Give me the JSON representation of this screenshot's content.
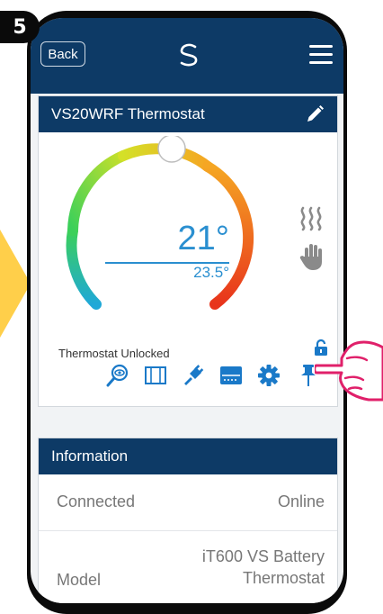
{
  "step_number": "5",
  "topbar": {
    "back_label": "Back",
    "logo_icon": "salus-logo-icon",
    "menu_icon": "hamburger-menu-icon"
  },
  "device": {
    "title": "VS20WRF Thermostat",
    "setpoint": "21°",
    "current_temp": "23.5°",
    "lock_status": "Thermostat Unlocked"
  },
  "tools": [
    "magnifier-eye-icon",
    "window-icon",
    "plug-icon",
    "display-icon",
    "gear-icon",
    "pin-icon"
  ],
  "information": {
    "title": "Information",
    "rows": [
      {
        "label": "Connected",
        "value": "Online"
      },
      {
        "label": "Model",
        "value_line1": "iT600 VS Battery",
        "value_line2": "Thermostat"
      }
    ]
  },
  "colors": {
    "header": "#0d3a66",
    "accent": "#2a8fd0",
    "highlight": "#ffcf4a"
  }
}
